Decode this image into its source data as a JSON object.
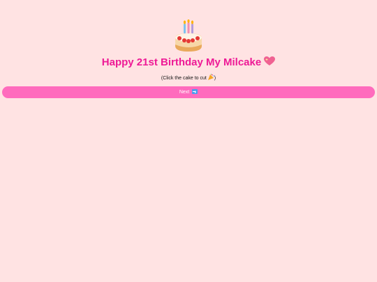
{
  "cake": {
    "icon": "birthday-cake-icon"
  },
  "title": {
    "text": "Happy 21st Birthday My Milcake",
    "heart_icon": "sparkling-heart-icon",
    "color": "#ee1a96"
  },
  "hint": {
    "text": "(Click the cake to cut",
    "party_icon": "party-popper-icon",
    "close": ")"
  },
  "next_button": {
    "label": "Next",
    "arrow_icon": "right-arrow-icon",
    "color": "#ff6bbd"
  },
  "background": "#ffe3e3"
}
